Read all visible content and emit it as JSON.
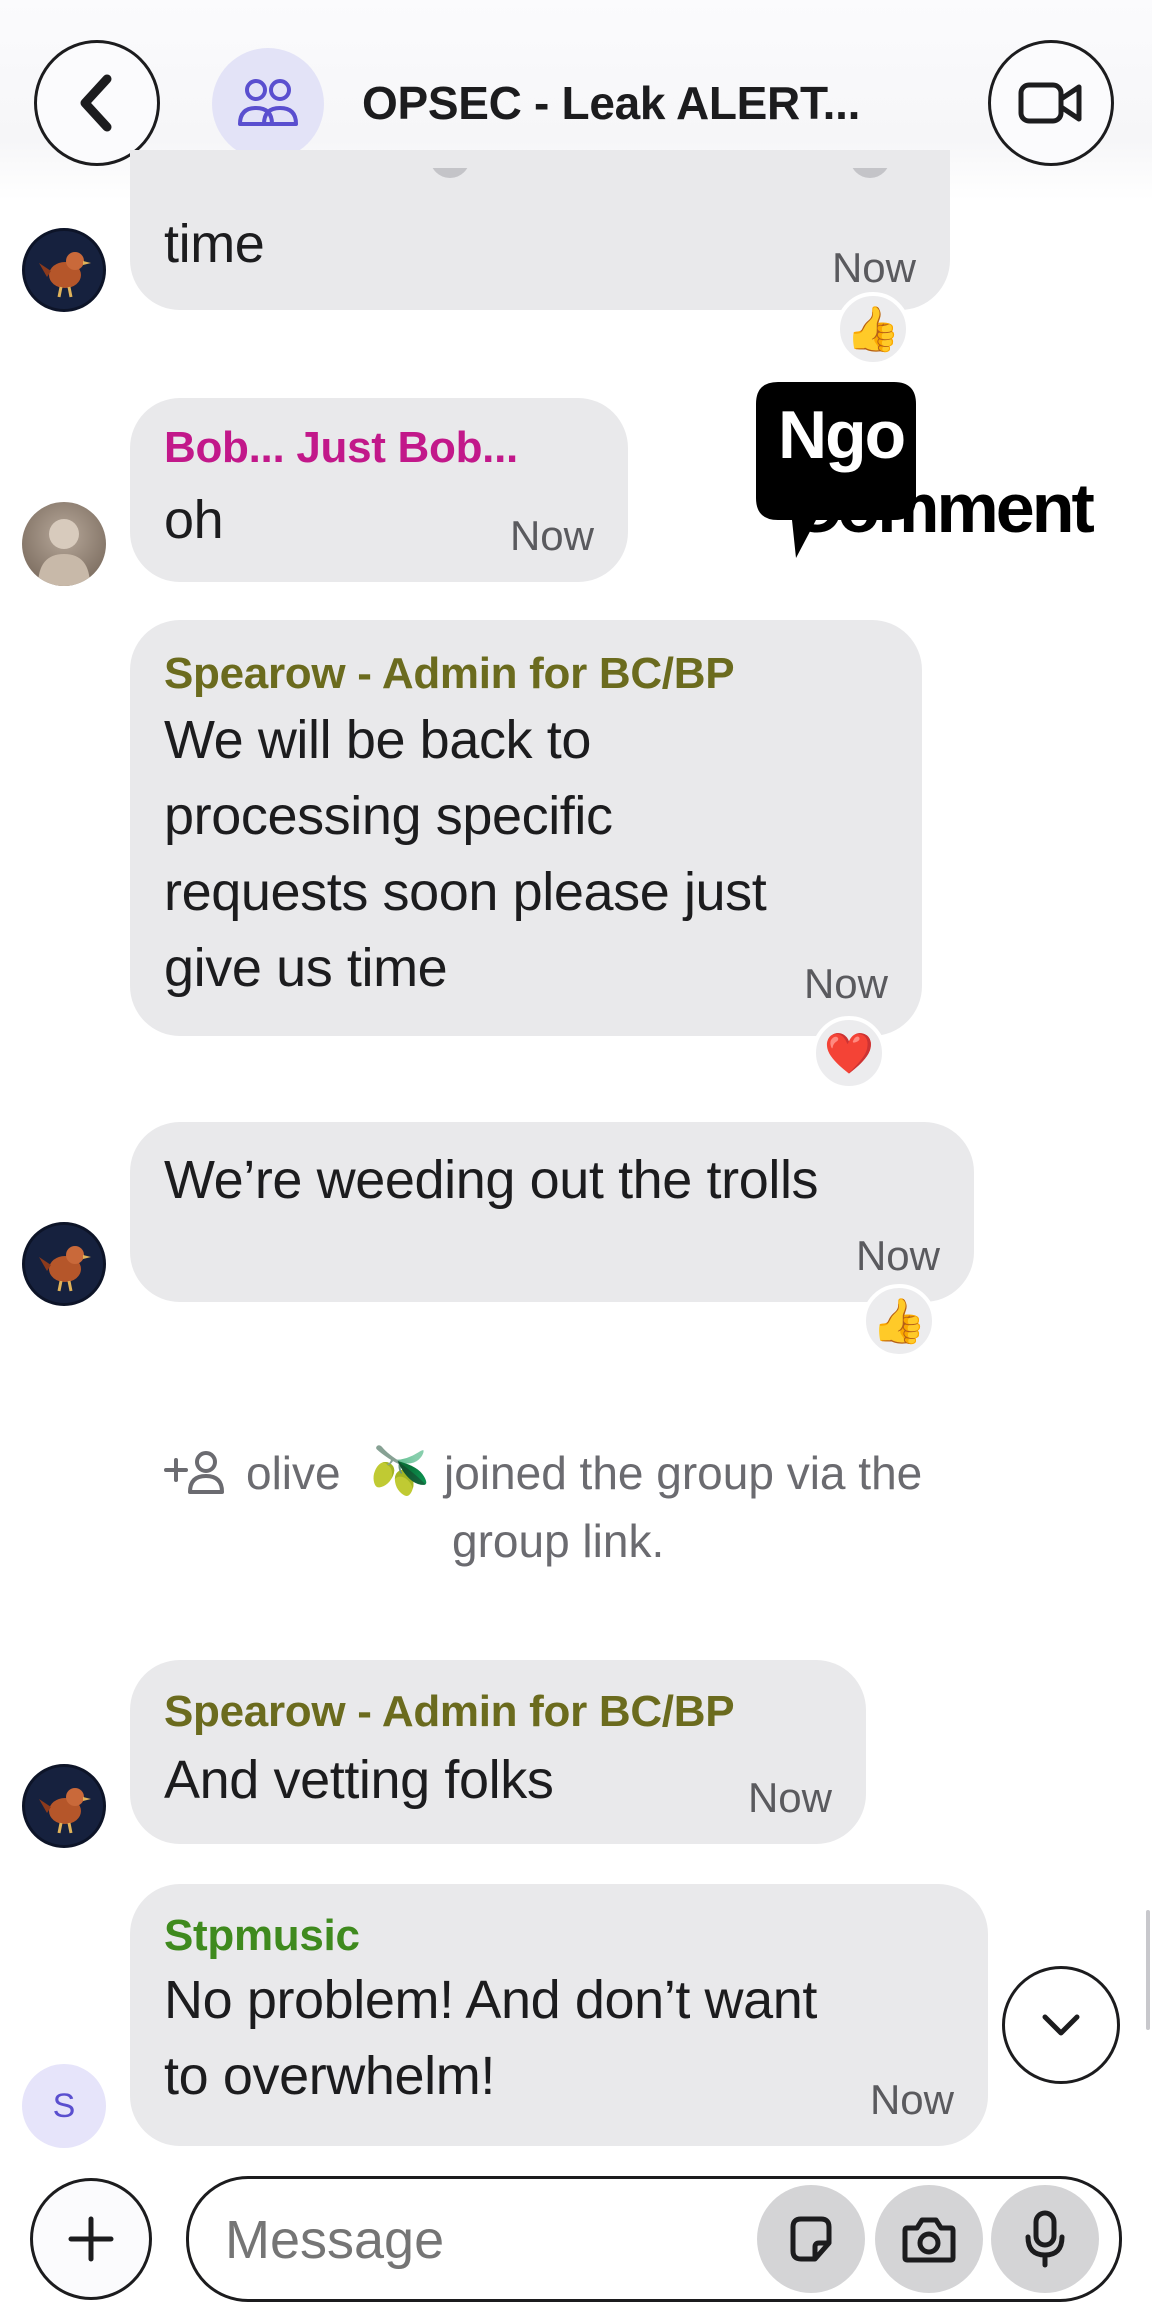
{
  "header": {
    "title": "OPSEC - Leak ALERT..."
  },
  "messages": [
    {
      "id": "m1",
      "text": "time",
      "time": "Now",
      "reaction": "👍"
    },
    {
      "id": "m2",
      "sender": "Bob... Just Bob...",
      "sender_color": "#c2188a",
      "text": "oh",
      "time": "Now"
    },
    {
      "id": "m3",
      "sender": "Spearow - Admin for BC/BP",
      "sender_color": "#6b6b1e",
      "lines": [
        "We will be back to",
        "processing specific",
        "requests soon please just",
        "give us time"
      ],
      "time": "Now",
      "reaction": "❤️"
    },
    {
      "id": "m4",
      "text": "We’re weeding out the trolls",
      "time": "Now",
      "reaction": "👍"
    },
    {
      "id": "m5",
      "sender": "Spearow - Admin for BC/BP",
      "sender_color": "#6b6b1e",
      "text": "And vetting folks",
      "time": "Now"
    },
    {
      "id": "m6",
      "sender": "Stpmusic",
      "sender_color": "#3f8a1e",
      "lines": [
        "No problem! And don’t want",
        "to overwhelm!"
      ],
      "time": "Now",
      "avatar_letter": "S"
    }
  ],
  "system_event": {
    "user": "olive",
    "emoji": "🫒",
    "line1_rest": "joined the group via the",
    "line2": "group link."
  },
  "watermark": {
    "line1": "Ngo",
    "line2": "Comment"
  },
  "composer": {
    "placeholder": "Message"
  },
  "icons": {
    "back": "chevron-left-icon",
    "group": "group-icon",
    "video": "video-camera-icon",
    "scroll_down": "chevron-down-icon",
    "add": "plus-icon",
    "sticker": "sticker-icon",
    "camera": "camera-icon",
    "mic": "microphone-icon",
    "add_person": "add-person-icon"
  }
}
